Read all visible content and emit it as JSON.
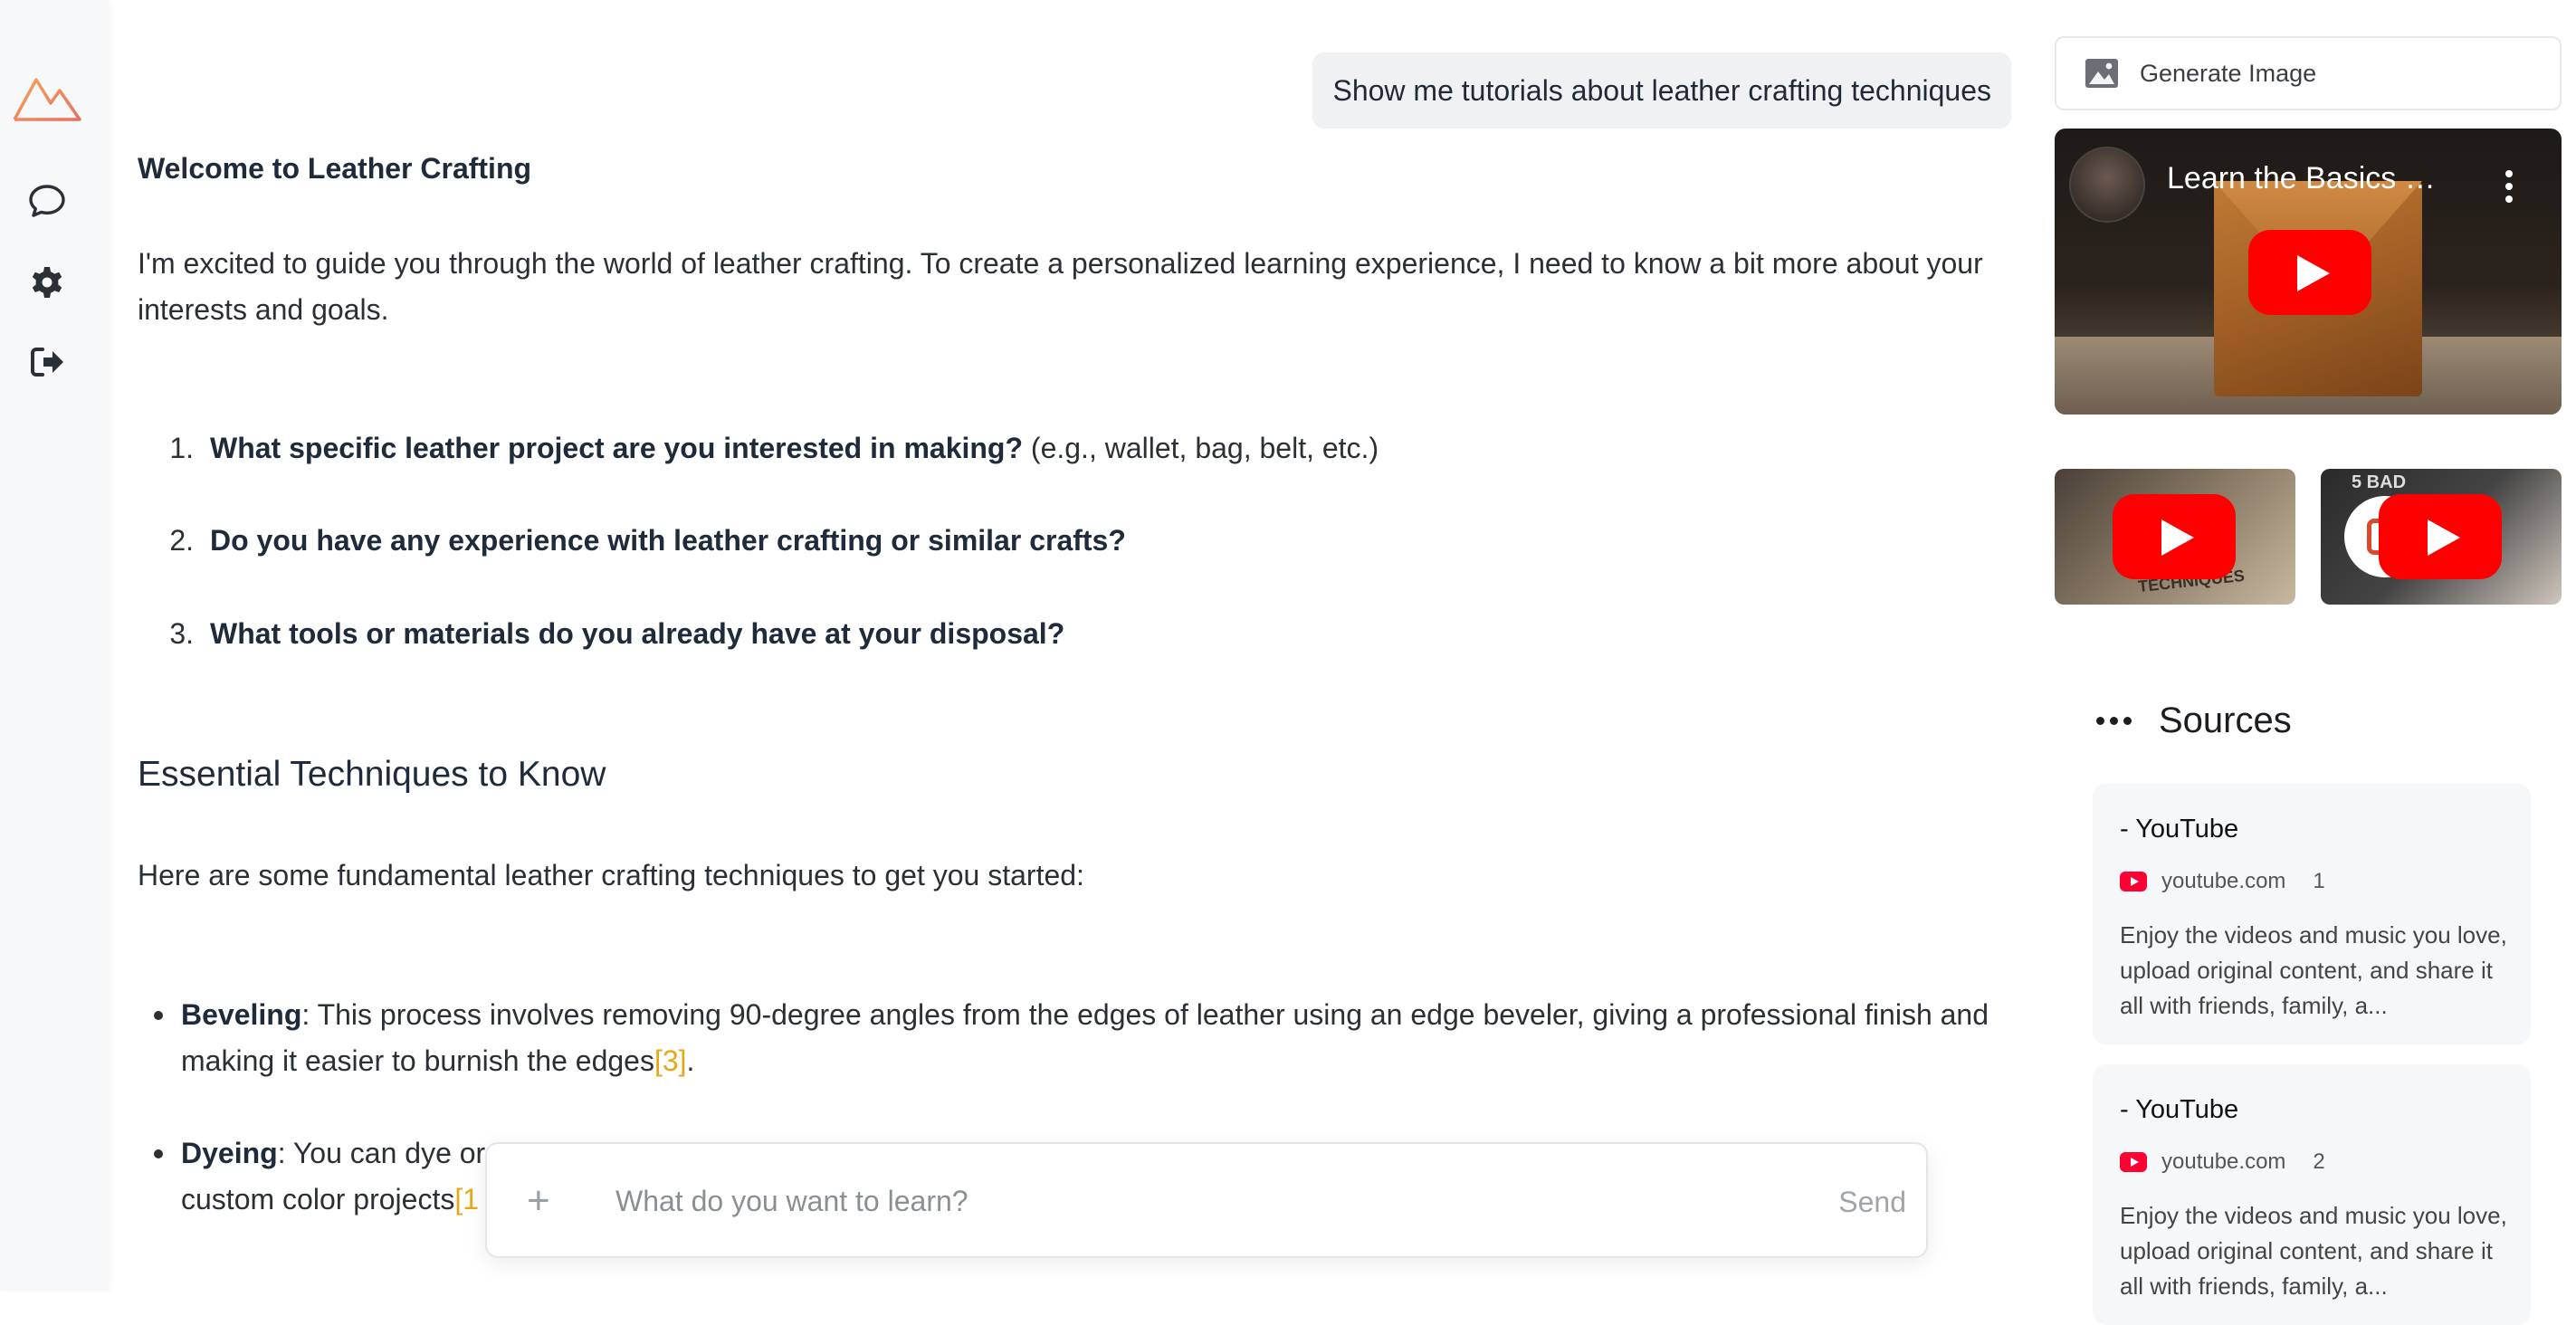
{
  "sidebar": {
    "icons": [
      "logo-mountain-icon",
      "chat-bubble-icon",
      "gear-icon",
      "sign-out-icon"
    ]
  },
  "conversation": {
    "user_message": "Show me tutorials about leather crafting techniques",
    "welcome_heading": "Welcome to Leather Crafting",
    "intro": "I'm excited to guide you through the world of leather crafting. To create a personalized learning experience, I need to know a bit more about your interests and goals.",
    "questions": [
      {
        "num": "1.",
        "bold": "What specific leather project are you interested in making?",
        "rest": " (e.g., wallet, bag, belt, etc.)"
      },
      {
        "num": "2.",
        "bold": "Do you have any experience with leather crafting or similar crafts?",
        "rest": ""
      },
      {
        "num": "3.",
        "bold": "What tools or materials do you already have at your disposal?",
        "rest": ""
      }
    ],
    "section_heading": "Essential Techniques to Know",
    "section_intro": "Here are some fundamental leather crafting techniques to get you started:",
    "techniques": [
      {
        "name": "Beveling",
        "text": ": This process involves removing 90-degree angles from the edges of leather using an edge beveler, giving a professional finish and making it easier to burnish the edges",
        "cite": "[3]",
        "after": "."
      },
      {
        "name": "Dyeing",
        "text": ": You can dye or",
        "line2": "custom color projects",
        "cite": "[1",
        "after": ""
      }
    ]
  },
  "input": {
    "placeholder": "What do you want to learn?",
    "plus": "+",
    "send": "Send"
  },
  "right_panel": {
    "generate_image": "Generate Image",
    "main_video_title": "Learn the Basics …",
    "thumb_1_text": "TECHNIQUES",
    "thumb_2_text": "5 BAD",
    "sources_title": "Sources",
    "sources": [
      {
        "title": "- YouTube",
        "domain": "youtube.com",
        "num": "1",
        "desc": "Enjoy the videos and music you love, upload original content, and share it all with friends, family, a..."
      },
      {
        "title": "- YouTube",
        "domain": "youtube.com",
        "num": "2",
        "desc": "Enjoy the videos and music you love, upload original content, and share it all with friends, family, a..."
      }
    ]
  },
  "colors": {
    "citation": "#e6a817",
    "youtube_red": "#ff0000",
    "logo_orange": "#f08a5d"
  }
}
